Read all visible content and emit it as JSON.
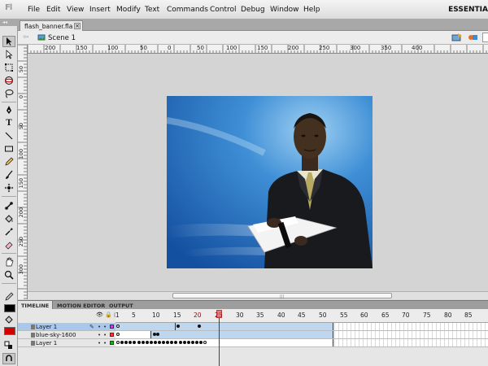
{
  "app": {
    "logo": "Fl",
    "workspace": "ESSENTIA"
  },
  "menu": [
    "File",
    "Edit",
    "View",
    "Insert",
    "Modify",
    "Text",
    "Commands",
    "Control",
    "Debug",
    "Window",
    "Help"
  ],
  "document": {
    "tab_label": "flash_banner.fla",
    "close_glyph": "×"
  },
  "editbar": {
    "back_glyph": "⇦",
    "scene_label": "Scene 1"
  },
  "tools_header": "◂◂",
  "hruler_labels": [
    "200",
    "150",
    "100",
    "50",
    "0",
    "50",
    "100",
    "150",
    "200",
    "250",
    "300",
    "350",
    "400"
  ],
  "vruler_labels": [
    "50",
    "0",
    "50",
    "100",
    "150",
    "200",
    "250",
    "300",
    "350"
  ],
  "panel": {
    "tabs": [
      "TIMELINE",
      "MOTION EDITOR",
      "OUTPUT"
    ],
    "frame_numbers": [
      "1",
      "5",
      "10",
      "15",
      "20",
      "25",
      "30",
      "35",
      "40",
      "45",
      "50",
      "55",
      "60",
      "65",
      "70",
      "75",
      "80",
      "85"
    ],
    "layers": [
      {
        "name": "Layer 1",
        "color": "#cc44cc",
        "active": true
      },
      {
        "name": "blue-sky-1600",
        "color": "#ff3333",
        "active": false
      },
      {
        "name": "Layer 1",
        "color": "#22aa22",
        "active": false
      }
    ],
    "current_frame": 20
  },
  "colors": {
    "stroke": "#000000",
    "fill": "#d40000",
    "stage_sky": "#2a6fb8"
  },
  "tools": [
    "selection-tool",
    "subselection-tool",
    "free-transform-tool",
    "3d-rotation-tool",
    "lasso-tool",
    "pen-tool",
    "text-tool",
    "line-tool",
    "rectangle-tool",
    "pencil-tool",
    "brush-tool",
    "deco-tool",
    "bone-tool",
    "paint-bucket-tool",
    "eyedropper-tool",
    "eraser-tool",
    "hand-tool",
    "zoom-tool"
  ]
}
